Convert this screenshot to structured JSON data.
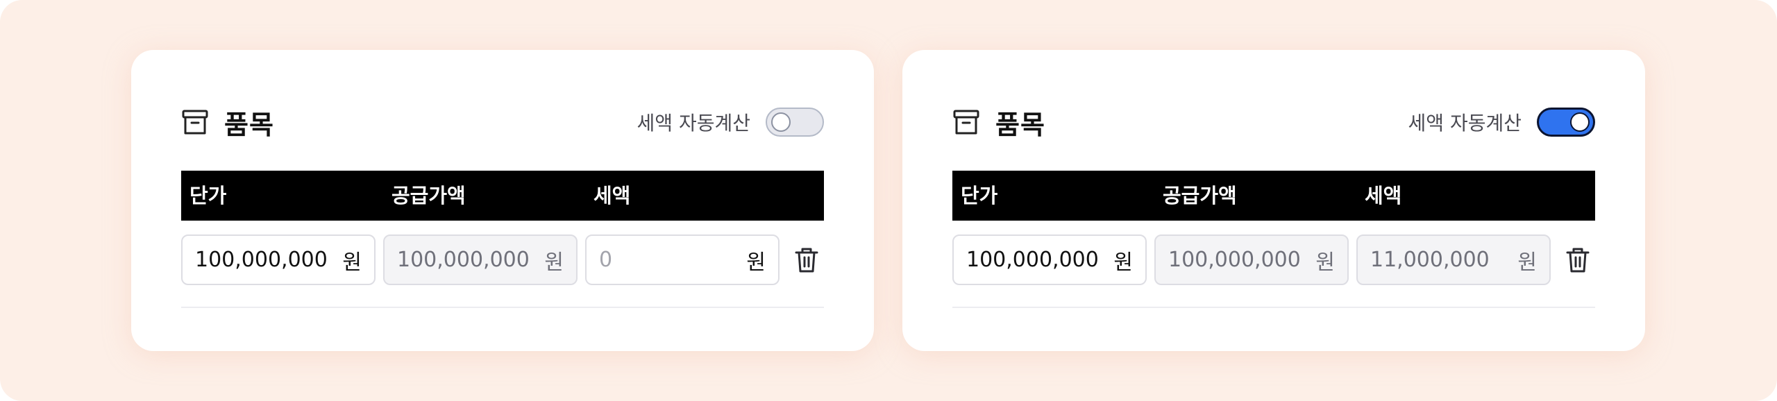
{
  "cards": [
    {
      "title": "품목",
      "title_icon": "archive-box-icon",
      "auto_tax_label": "세액 자동계산",
      "auto_tax_enabled": false,
      "columns": [
        "단가",
        "공급가액",
        "세액"
      ],
      "row": {
        "unit_price": "100,000,000",
        "unit_price_unit": "원",
        "supply_value": "100,000,000",
        "supply_value_unit": "원",
        "tax_placeholder": "0",
        "tax_unit": "원",
        "delete_icon": "trash-icon"
      }
    },
    {
      "title": "품목",
      "title_icon": "archive-box-icon",
      "auto_tax_label": "세액 자동계산",
      "auto_tax_enabled": true,
      "columns": [
        "단가",
        "공급가액",
        "세액"
      ],
      "row": {
        "unit_price": "100,000,000",
        "unit_price_unit": "원",
        "supply_value": "100,000,000",
        "supply_value_unit": "원",
        "tax_value": "11,000,000",
        "tax_unit": "원",
        "delete_icon": "trash-icon"
      }
    }
  ],
  "colors": {
    "background": "#fdefe7",
    "card": "#ffffff",
    "table_header": "#000000",
    "toggle_on": "#2f73ef",
    "toggle_off": "#e7e8ee",
    "disabled_field": "#f4f4f6"
  }
}
